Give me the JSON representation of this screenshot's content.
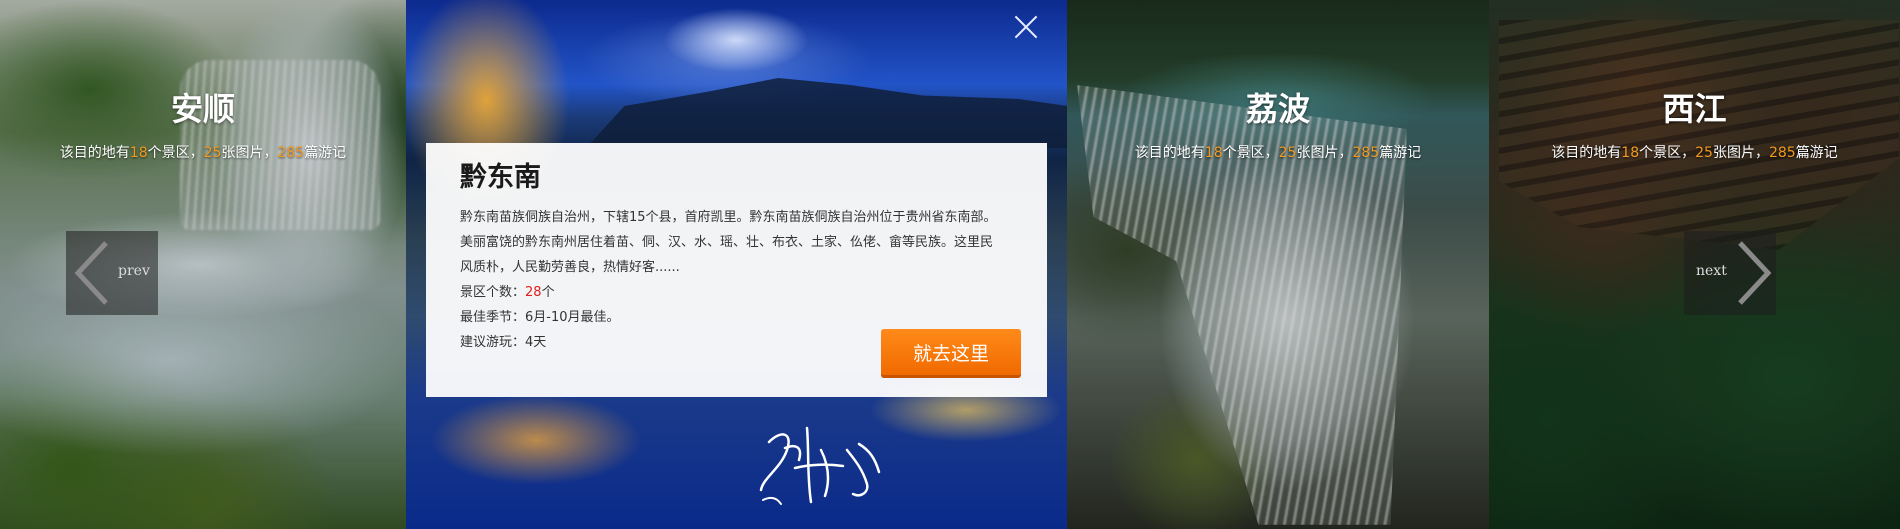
{
  "panels": {
    "anshun": {
      "name": "安顺",
      "stats": {
        "prefix": "该目的地有",
        "spots": "18",
        "spots_unit": "个景区，",
        "photos": "25",
        "photos_unit": "张图片，",
        "notes": "285",
        "notes_unit": "篇游记"
      }
    },
    "active": {
      "name": "黔东南",
      "description": "黔东南苗族侗族自治州，下辖15个县，首府凯里。黔东南苗族侗族自治州位于贵州省东南部。 美丽富饶的黔东南州居住着苗、侗、汉、水、瑶、壮、布衣、土家、仫佬、畲等民族。这里民风质朴，人民勤劳善良，热情好客......",
      "spots_label": "景区个数：",
      "spots_value": "28",
      "spots_unit": "个",
      "season_label": "最佳季节：",
      "season_value": "6月-10月最佳。",
      "duration_label": "建议游玩：",
      "duration_value": "4天",
      "go_label": "就去这里"
    },
    "libo": {
      "name": "荔波",
      "stats": {
        "prefix": "该目的地有",
        "spots": "18",
        "spots_unit": "个景区，",
        "photos": "25",
        "photos_unit": "张图片，",
        "notes": "285",
        "notes_unit": "篇游记"
      }
    },
    "xijiang": {
      "name": "西江",
      "stats": {
        "prefix": "该目的地有",
        "spots": "18",
        "spots_unit": "个景区，",
        "photos": "25",
        "photos_unit": "张图片，",
        "notes": "285",
        "notes_unit": "篇游记"
      }
    }
  },
  "nav": {
    "prev_label": "prev",
    "next_label": "next"
  },
  "icons": {
    "close": "close-icon",
    "prev": "chevron-left-icon",
    "next": "chevron-right-icon"
  },
  "colors": {
    "accent": "#f39a1e",
    "button": "#f06a00",
    "highlight": "#e02020"
  }
}
